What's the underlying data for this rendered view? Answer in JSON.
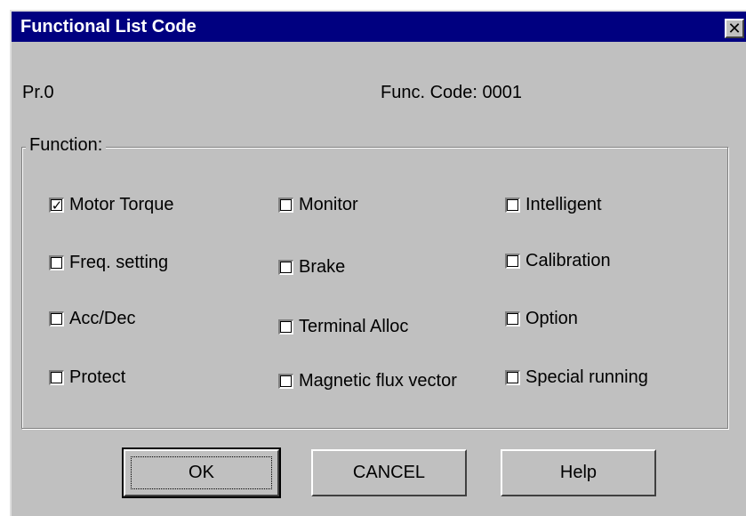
{
  "window": {
    "title": "Functional List Code",
    "close_glyph": "✕"
  },
  "header": {
    "param": "Pr.0",
    "func_code": "Func. Code: 0001"
  },
  "function_group": {
    "legend": "Function:",
    "options": [
      {
        "label": "Motor Torque",
        "checked": true
      },
      {
        "label": "Monitor",
        "checked": false
      },
      {
        "label": "Intelligent",
        "checked": false
      },
      {
        "label": "Freq. setting",
        "checked": false
      },
      {
        "label": "Brake",
        "checked": false
      },
      {
        "label": "Calibration",
        "checked": false
      },
      {
        "label": "Acc/Dec",
        "checked": false
      },
      {
        "label": "Terminal Alloc",
        "checked": false
      },
      {
        "label": "Option",
        "checked": false
      },
      {
        "label": "Protect",
        "checked": false
      },
      {
        "label": "Magnetic flux vector",
        "checked": false
      },
      {
        "label": "Special running",
        "checked": false
      }
    ]
  },
  "buttons": {
    "ok": "OK",
    "cancel": "CANCEL",
    "help": "Help"
  }
}
